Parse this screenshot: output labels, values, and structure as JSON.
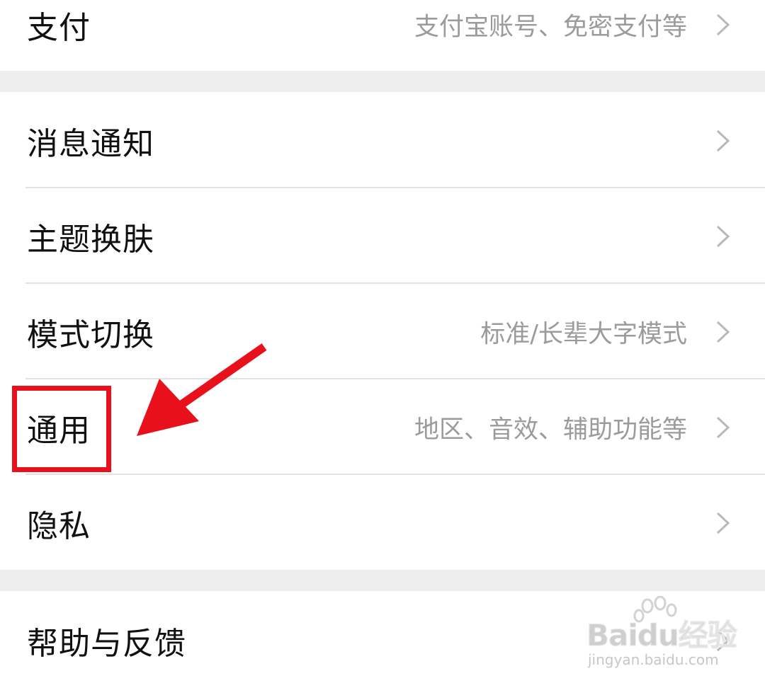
{
  "settings": {
    "rows": [
      {
        "title": "支付",
        "subtitle": "支付宝账号、免密支付等"
      },
      {
        "title": "消息通知",
        "subtitle": ""
      },
      {
        "title": "主题换肤",
        "subtitle": ""
      },
      {
        "title": "模式切换",
        "subtitle": "标准/长辈大字模式"
      },
      {
        "title": "通用",
        "subtitle": "地区、音效、辅助功能等"
      },
      {
        "title": "隐私",
        "subtitle": ""
      },
      {
        "title": "帮助与反馈",
        "subtitle": ""
      }
    ]
  },
  "annotation": {
    "highlight_color": "#e8101b",
    "arrow_color": "#e8101b"
  },
  "watermark": {
    "logo": "Baidu经验",
    "url": "jingyan.baidu.com"
  },
  "icons": {
    "chevron": "chevron-right-icon"
  }
}
